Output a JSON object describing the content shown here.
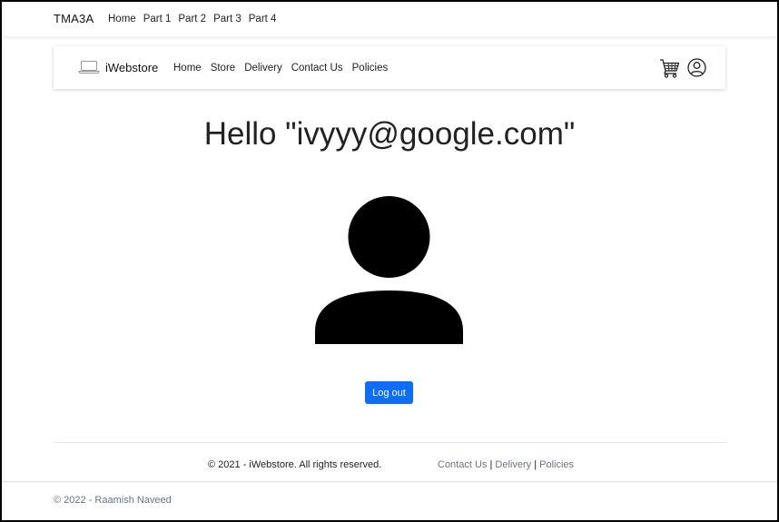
{
  "topnav": {
    "brand": "TMA3A",
    "links": [
      "Home",
      "Part 1",
      "Part 2",
      "Part 3",
      "Part 4"
    ]
  },
  "innernav": {
    "brand": "iWebstore",
    "links": [
      "Home",
      "Store",
      "Delivery",
      "Contact Us",
      "Policies"
    ],
    "icons": [
      "laptop-icon",
      "cart-icon",
      "user-circle-icon"
    ]
  },
  "main": {
    "greeting": "Hello \"ivyyy@google.com\"",
    "logout_label": "Log out"
  },
  "footer": {
    "copyright": "© 2021 - iWebstore. All rights reserved.",
    "links": [
      "Contact Us",
      "Delivery",
      "Policies"
    ],
    "separator": "|",
    "credit": "© 2022 - Raamish Naveed"
  },
  "colors": {
    "primary": "#0d6efd",
    "muted": "#6c757d"
  }
}
